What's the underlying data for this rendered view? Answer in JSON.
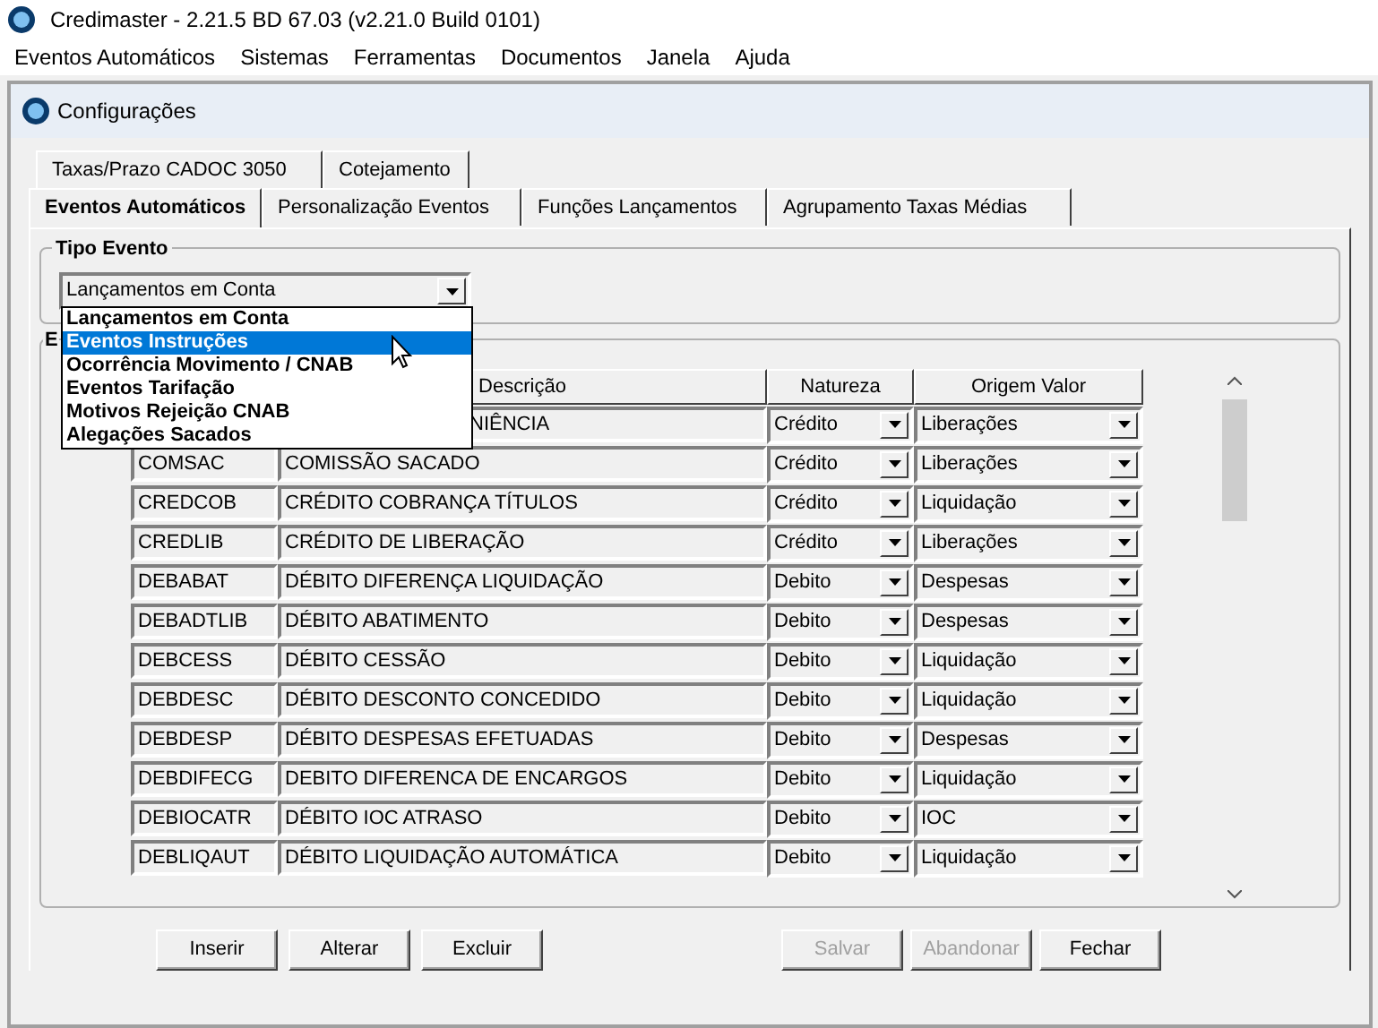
{
  "window": {
    "title": "Credimaster - 2.21.5 BD 67.03 (v2.21.0 Build 0101)"
  },
  "menu": [
    "Eventos Automáticos",
    "Sistemas",
    "Ferramentas",
    "Documentos",
    "Janela",
    "Ajuda"
  ],
  "child_window": {
    "title": "Configurações"
  },
  "tabs_back_row": [
    {
      "label": "Taxas/Prazo CADOC 3050",
      "selected": false
    },
    {
      "label": "Cotejamento",
      "selected": false
    }
  ],
  "tabs_front_row": [
    {
      "label": "Eventos Automáticos",
      "selected": true
    },
    {
      "label": "Personalização Eventos",
      "selected": false
    },
    {
      "label": "Funções Lançamentos",
      "selected": false
    },
    {
      "label": "Agrupamento Taxas Médias",
      "selected": false
    }
  ],
  "tipo_evento": {
    "label": "Tipo Evento",
    "value": "Lançamentos em Conta",
    "expanded": true,
    "options": [
      {
        "label": "Lançamentos em Conta",
        "highlighted": false
      },
      {
        "label": "Eventos Instruções",
        "highlighted": true
      },
      {
        "label": "Ocorrência Movimento / CNAB",
        "highlighted": false
      },
      {
        "label": "Eventos Tarifação",
        "highlighted": false
      },
      {
        "label": "Motivos Rejeição CNAB",
        "highlighted": false
      },
      {
        "label": "Alegações Sacados",
        "highlighted": false
      }
    ]
  },
  "events_group": {
    "label": "E"
  },
  "table": {
    "columns": [
      "Descrição",
      "Natureza",
      "Origem Valor"
    ],
    "rows": [
      {
        "description": "NIÊNCIA",
        "natureza": "Crédito",
        "origem": "Liberações"
      },
      {
        "code": "COMSAC",
        "description": "COMISSÃO SACADO",
        "natureza": "Crédito",
        "origem": "Liberações"
      },
      {
        "code": "CREDCOB",
        "description": "CRÉDITO COBRANÇA TÍTULOS",
        "natureza": "Crédito",
        "origem": "Liquidação"
      },
      {
        "code": "CREDLIB",
        "description": "CRÉDITO DE LIBERAÇÃO",
        "natureza": "Crédito",
        "origem": "Liberações"
      },
      {
        "code": "DEBABAT",
        "description": "DÉBITO DIFERENÇA LIQUIDAÇÃO",
        "natureza": "Debito",
        "origem": "Despesas"
      },
      {
        "code": "DEBADTLIB",
        "description": "DÉBITO ABATIMENTO",
        "natureza": "Debito",
        "origem": "Despesas"
      },
      {
        "code": "DEBCESS",
        "description": "DÉBITO CESSÃO",
        "natureza": "Debito",
        "origem": "Liquidação"
      },
      {
        "code": "DEBDESC",
        "description": "DÉBITO DESCONTO CONCEDIDO",
        "natureza": "Debito",
        "origem": "Liquidação"
      },
      {
        "code": "DEBDESP",
        "description": "DÉBITO DESPESAS EFETUADAS",
        "natureza": "Debito",
        "origem": "Despesas"
      },
      {
        "code": "DEBDIFECG",
        "description": "DEBITO DIFERENCA DE ENCARGOS",
        "natureza": "Debito",
        "origem": "Liquidação"
      },
      {
        "code": "DEBIOCATR",
        "description": "DÉBITO IOC ATRASO",
        "natureza": "Debito",
        "origem": "IOC"
      },
      {
        "code": "DEBLIQAUT",
        "description": "DÉBITO LIQUIDAÇÃO AUTOMÁTICA",
        "natureza": "Debito",
        "origem": "Liquidação"
      }
    ]
  },
  "buttons_left": [
    {
      "label": "Inserir",
      "disabled": false
    },
    {
      "label": "Alterar",
      "disabled": false
    },
    {
      "label": "Excluir",
      "disabled": false
    }
  ],
  "buttons_right": [
    {
      "label": "Salvar",
      "disabled": true
    },
    {
      "label": "Abandonar",
      "disabled": true
    },
    {
      "label": "Fechar",
      "disabled": false
    }
  ]
}
